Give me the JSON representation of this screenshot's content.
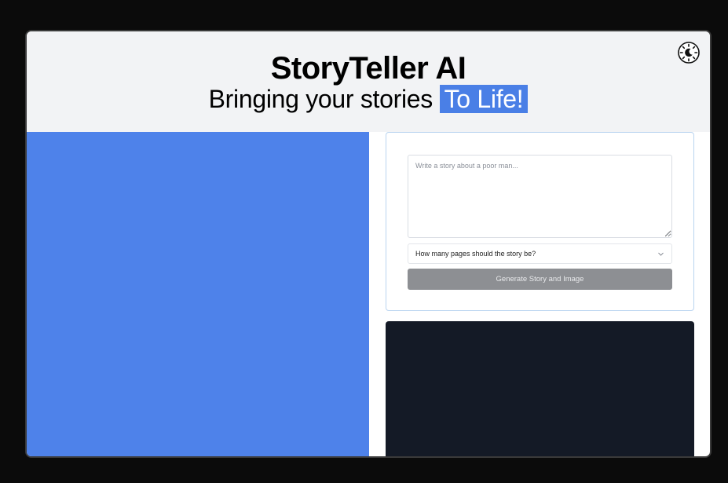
{
  "app": {
    "title": "StoryTeller AI",
    "subtitle_prefix": "Bringing your stories",
    "subtitle_highlight": "To Life!"
  },
  "theme_toggle": {
    "icon": "theme-toggle-icon"
  },
  "form": {
    "story_placeholder": "Write a story about a poor man...",
    "story_value": "",
    "pages_select": {
      "selected": "How many pages should the story be?",
      "icon": "chevron-down-icon"
    },
    "generate_label": "Generate Story and Image"
  },
  "colors": {
    "highlight": "#4a7fe6",
    "left_panel": "#4e82ea",
    "dark_panel": "#141a26",
    "button_disabled": "#8d8f93",
    "card_border": "#b9d4f0"
  }
}
